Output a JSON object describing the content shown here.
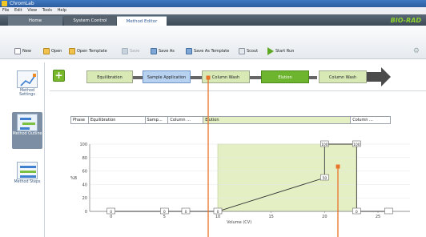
{
  "window": {
    "title": "ChromLab"
  },
  "menu": [
    "File",
    "Edit",
    "View",
    "Tools",
    "Help"
  ],
  "tabs": [
    {
      "label": "Home"
    },
    {
      "label": "System Control"
    },
    {
      "label": "Method Editor"
    }
  ],
  "brand": "BIO-RAD",
  "toolbar": {
    "new": "New",
    "open": "Open",
    "open_template": "Open Template",
    "save": "Save",
    "save_as": "Save As",
    "save_as_template": "Save As Template",
    "scout": "Scout",
    "start_run": "Start Run"
  },
  "nav": [
    {
      "label": "Method Settings"
    },
    {
      "label": "Method Outline"
    },
    {
      "label": "Method Steps"
    }
  ],
  "workflow": [
    "Equilibration",
    "Sample Application",
    "Column Wash",
    "Elution",
    "Column Wash"
  ],
  "phases": [
    "Phase",
    "Equilibration",
    "Samp...",
    "Column ...",
    "Elution",
    "Column ..."
  ],
  "chart": {
    "ylabel": "%B",
    "xlabel": "Volume (CV)",
    "yticks": [
      "100",
      "80",
      "60",
      "40",
      "20",
      "0"
    ],
    "xticks": [
      "0",
      "5",
      "10",
      "15",
      "20",
      "25"
    ],
    "markers": [
      "0",
      "0",
      "0",
      "0",
      "50",
      "100",
      "100",
      "0"
    ]
  },
  "colors": {
    "accent_green": "#76b829",
    "elution_fill": "#e4f0c4",
    "callout_line": "#e8742a",
    "gradient_line": "#333333"
  },
  "chart_data": {
    "type": "line",
    "xlabel": "Volume (CV)",
    "ylabel": "%B",
    "ylim": [
      0,
      100
    ],
    "xlim": [
      -2,
      28
    ],
    "series": [
      {
        "x": [
          0,
          5,
          7,
          10,
          20,
          20,
          23,
          23,
          26
        ],
        "y": [
          0,
          0,
          0,
          0,
          50,
          100,
          100,
          0,
          0
        ]
      }
    ],
    "elution_region": [
      10,
      23
    ]
  }
}
